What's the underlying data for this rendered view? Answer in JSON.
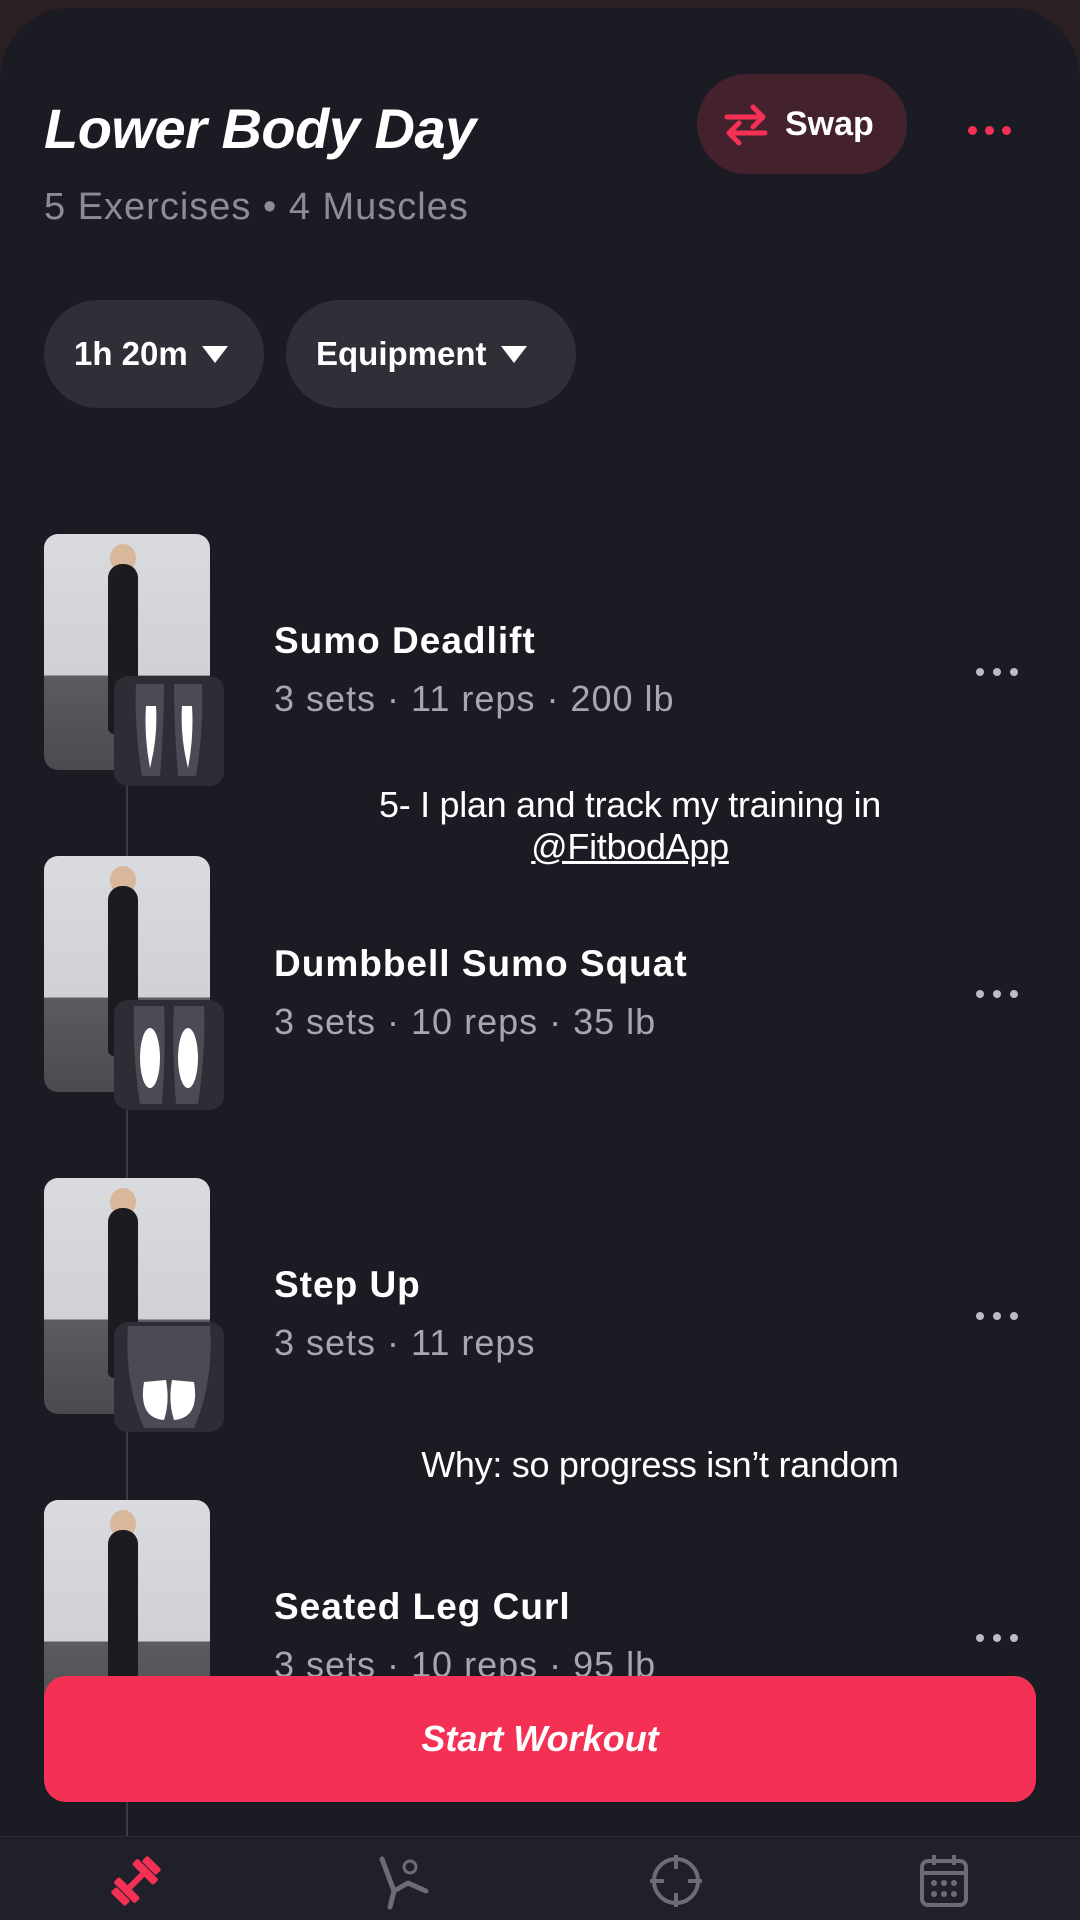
{
  "header": {
    "title": "Lower Body Day",
    "subtitle": "5 Exercises • 4 Muscles",
    "swap_label": "Swap"
  },
  "filters": [
    {
      "label": "1h 20m"
    },
    {
      "label": "Equipment"
    }
  ],
  "exercises": [
    {
      "name": "Sumo Deadlift",
      "meta": "3 sets · 11 reps · 200 lb",
      "muscle_icon": "hamstrings-icon"
    },
    {
      "name": "Dumbbell Sumo Squat",
      "meta": "3 sets · 10 reps · 35 lb",
      "muscle_icon": "quads-icon"
    },
    {
      "name": "Step Up",
      "meta": "3 sets · 11 reps",
      "muscle_icon": "glutes-icon"
    },
    {
      "name": "Seated Leg Curl",
      "meta": "3 sets · 10 reps · 95 lb",
      "muscle_icon": "hamstrings-icon"
    }
  ],
  "captions": {
    "line1": "5- I plan and track my training in",
    "handle": "@FitbodApp",
    "why": "Why:  so progress isn’t random"
  },
  "start_button": "Start Workout",
  "nav": [
    {
      "icon": "dumbbell-icon",
      "active": true
    },
    {
      "icon": "body-icon",
      "active": false
    },
    {
      "icon": "target-icon",
      "active": false
    },
    {
      "icon": "calendar-icon",
      "active": false
    }
  ],
  "colors": {
    "background": "#1b1b23",
    "accent": "#f43155",
    "chip": "#2f2f38",
    "swap_bg": "#43222e",
    "muted_text": "#a7a7b0"
  }
}
